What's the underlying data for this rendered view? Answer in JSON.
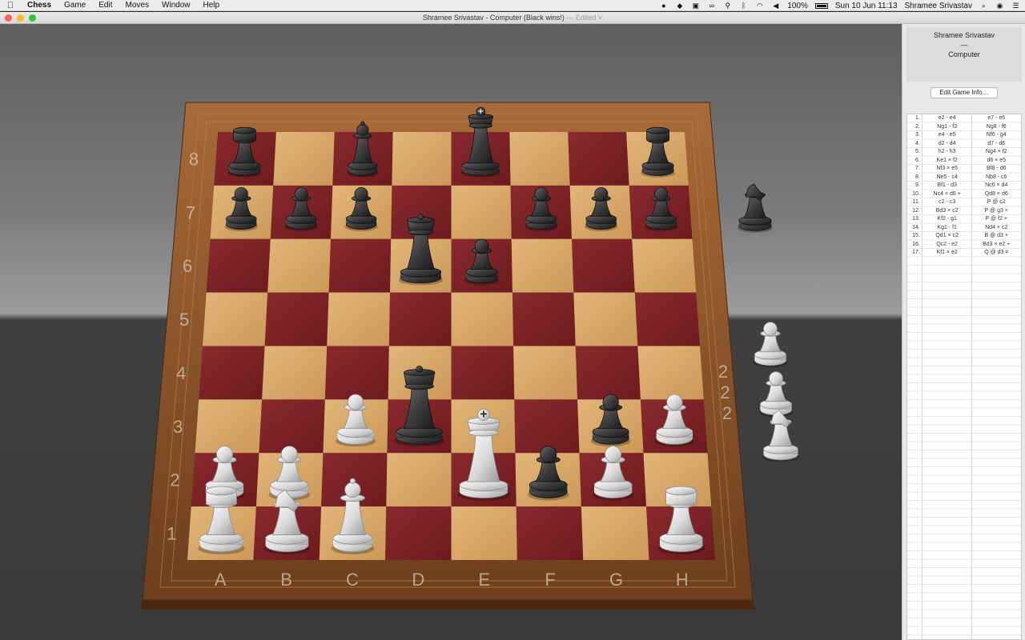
{
  "menubar": {
    "app_name": "Chess",
    "menus": [
      "Game",
      "Edit",
      "Moves",
      "Window",
      "Help"
    ],
    "battery": "100%",
    "datetime": "Sun 10 Jun  11:13",
    "user": "Shramee Srivastav"
  },
  "window": {
    "title": "Shramee Srivastav - Computer   (Black wins!)",
    "edited": "— Edited ˅"
  },
  "players": {
    "white": "Shramee Srivastav",
    "separator": "—",
    "black": "Computer"
  },
  "edit_info_label": "Edit Game Info…",
  "board": {
    "files": [
      "A",
      "B",
      "C",
      "D",
      "E",
      "F",
      "G",
      "H"
    ],
    "ranks": [
      "1",
      "2",
      "3",
      "4",
      "5",
      "6",
      "7",
      "8"
    ],
    "reserve_counts": [
      "2",
      "2",
      "2"
    ],
    "pieces": [
      {
        "color": "black",
        "type": "rook",
        "square": "a8"
      },
      {
        "color": "black",
        "type": "bishop",
        "square": "c8"
      },
      {
        "color": "black",
        "type": "king",
        "square": "e8"
      },
      {
        "color": "black",
        "type": "rook",
        "square": "h8"
      },
      {
        "color": "black",
        "type": "pawn",
        "square": "a7"
      },
      {
        "color": "black",
        "type": "pawn",
        "square": "b7"
      },
      {
        "color": "black",
        "type": "pawn",
        "square": "c7"
      },
      {
        "color": "black",
        "type": "pawn",
        "square": "f7"
      },
      {
        "color": "black",
        "type": "pawn",
        "square": "g7"
      },
      {
        "color": "black",
        "type": "pawn",
        "square": "h7"
      },
      {
        "color": "black",
        "type": "queen",
        "square": "d6"
      },
      {
        "color": "black",
        "type": "pawn",
        "square": "e6"
      },
      {
        "color": "black",
        "type": "queen",
        "square": "d3"
      },
      {
        "color": "black",
        "type": "pawn",
        "square": "g3"
      },
      {
        "color": "black",
        "type": "pawn",
        "square": "f2"
      },
      {
        "color": "white",
        "type": "pawn",
        "square": "c3"
      },
      {
        "color": "white",
        "type": "pawn",
        "square": "h3"
      },
      {
        "color": "white",
        "type": "pawn",
        "square": "a2"
      },
      {
        "color": "white",
        "type": "pawn",
        "square": "b2"
      },
      {
        "color": "white",
        "type": "king",
        "square": "e2"
      },
      {
        "color": "white",
        "type": "pawn",
        "square": "g2"
      },
      {
        "color": "white",
        "type": "rook",
        "square": "a1"
      },
      {
        "color": "white",
        "type": "knight",
        "square": "b1"
      },
      {
        "color": "white",
        "type": "bishop",
        "square": "c1"
      },
      {
        "color": "white",
        "type": "rook",
        "square": "h1"
      }
    ],
    "captured_black": [
      {
        "type": "knight",
        "color": "black"
      }
    ],
    "captured_white": [
      {
        "type": "pawn",
        "count": "2"
      },
      {
        "type": "pawn",
        "count": "2"
      },
      {
        "type": "knight",
        "count": "2"
      }
    ]
  },
  "moves": [
    {
      "n": "1.",
      "w": "e2  -  e4",
      "b": "e7  -  e6"
    },
    {
      "n": "2.",
      "w": "Ng1  -  f3",
      "b": "Ng8  -  f6"
    },
    {
      "n": "3.",
      "w": "e4  -  e5",
      "b": "Nf6  -  g4"
    },
    {
      "n": "4.",
      "w": "d2  -  d4",
      "b": "d7  -  d6"
    },
    {
      "n": "5.",
      "w": "h2  -  h3",
      "b": "Ng4  ×  f2"
    },
    {
      "n": "6.",
      "w": "Ke1  ×  f2",
      "b": "d6  ×  e5"
    },
    {
      "n": "7.",
      "w": "Nf3  ×  e5",
      "b": "Bf8  -  d6"
    },
    {
      "n": "8.",
      "w": "Ne5  -  c4",
      "b": "Nb8  -  c6"
    },
    {
      "n": "9.",
      "w": "Bf1  -  d3",
      "b": "Nc6  ×  d4"
    },
    {
      "n": "10.",
      "w": "Nc4  ×  d6 +",
      "b": "Qd8  ×  d6"
    },
    {
      "n": "11.",
      "w": "c2  -  c3",
      "b": "P  @ c2"
    },
    {
      "n": "12.",
      "w": "Bd3  ×  c2",
      "b": "P  @ g3 +"
    },
    {
      "n": "13.",
      "w": "Kf2  -  g1",
      "b": "P  @ f2 +"
    },
    {
      "n": "14.",
      "w": "Kg1  -  f1",
      "b": "Nd4  ×  c2"
    },
    {
      "n": "15.",
      "w": "Qd1  ×  c2",
      "b": "B  @ d3 +"
    },
    {
      "n": "16.",
      "w": "Qc2  -  e2",
      "b": "Bd3  ×  e2 +"
    },
    {
      "n": "17.",
      "w": "Kf1  ×  e2",
      "b": "Q  @ d3 ≠"
    }
  ],
  "colors": {
    "light_square": "#d9a86a",
    "dark_square": "#7a1f23",
    "frame": "#8a5228",
    "close": "#fc5f57",
    "minimize": "#fdbc2e",
    "zoom": "#29c840"
  }
}
